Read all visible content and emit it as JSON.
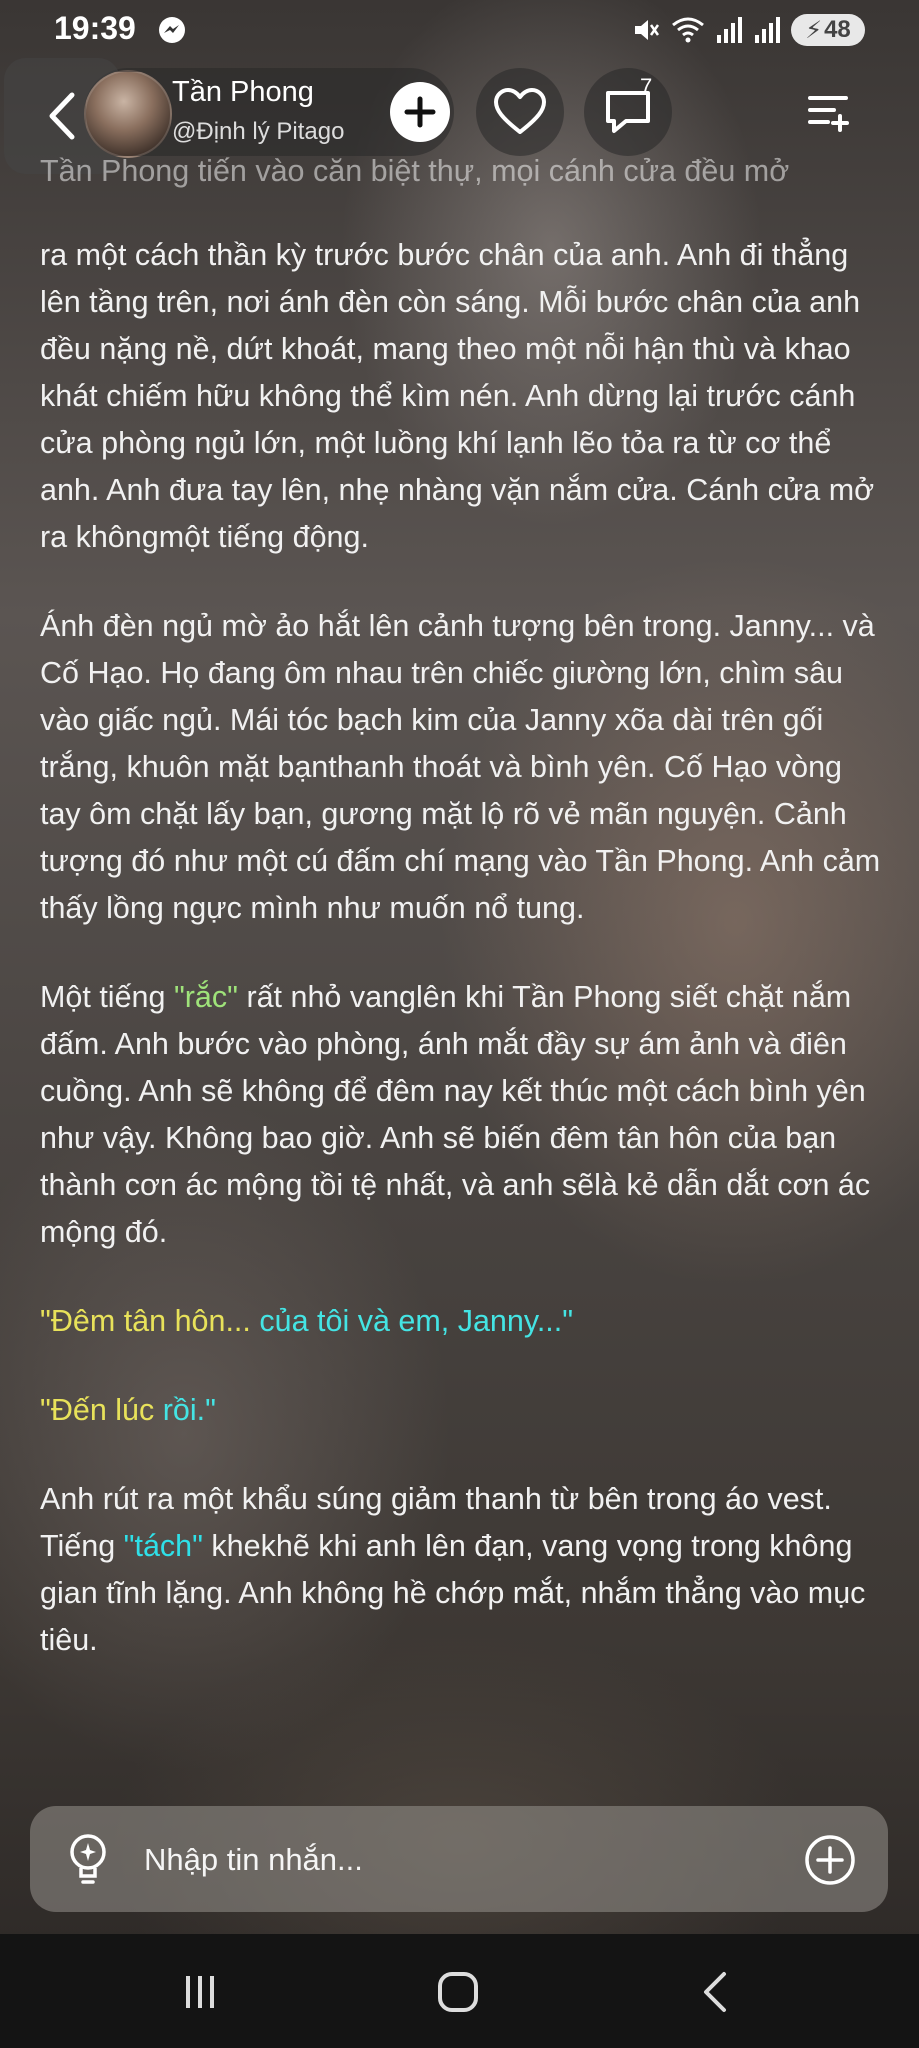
{
  "status_bar": {
    "time": "19:39",
    "battery": "48",
    "icons": [
      "messenger-icon",
      "mute-icon",
      "wifi-icon",
      "signal-icon",
      "signal-icon",
      "battery-charging-icon"
    ]
  },
  "header": {
    "back_icon": "chevron-left-icon",
    "profile_name": "Tần Phong",
    "profile_handle": "@Định lý Pitago",
    "follow_icon": "plus-icon",
    "like_icon": "heart-icon",
    "comment_icon": "comment-icon",
    "comment_count": "7",
    "menu_icon": "playlist-add-icon"
  },
  "story": {
    "p0": "Tần Phong tiến vào căn biệt thự, mọi cánh cửa đều mở",
    "p1": "ra một cách thần kỳ trước bước chân của anh. Anh đi thẳng lên tầng trên, nơi ánh đèn còn sáng. Mỗi bước chân của anh đều nặng nề, dứt khoát, mang theo một nỗi hận thù và khao khát chiếm hữu không thể kìm nén. Anh dừng lại trước cánh cửa phòng ngủ lớn, một luồng khí lạnh lẽo tỏa ra từ cơ thể anh. Anh đưa tay lên, nhẹ nhàng vặn nắm cửa. Cánh cửa mở ra khôngmột tiếng động.",
    "p2": "Ánh đèn ngủ mờ ảo hắt lên cảnh tượng bên trong. Janny... và Cố Hạo. Họ đang ôm nhau trên chiếc giường lớn, chìm sâu vào giấc ngủ. Mái tóc bạch kim của Janny xõa dài trên gối trắng, khuôn mặt bạnthanh thoát và bình yên. Cố Hạo vòng tay ôm chặt lấy bạn, gương mặt lộ rõ vẻ mãn nguyện. Cảnh tượng đó như một cú đấm chí mạng vào Tần Phong. Anh cảm thấy lồng ngực mình như muốn nổ tung.",
    "p3_a": "Một tiếng ",
    "p3_hl": "\"rắc\"",
    "p3_b": " rất nhỏ vanglên khi Tần Phong siết chặt nắm đấm. Anh bước vào phòng, ánh mắt đầy sự ám ảnh và điên cuồng. Anh sẽ không để đêm nay kết thúc một cách bình yên như vậy. Không bao giờ. Anh sẽ biến đêm tân hôn của bạn thành cơn ác mộng tồi tệ nhất, và anh sẽlà kẻ dẫn dắt cơn ác mộng đó.",
    "q1_a": "\"Đêm tân hôn...",
    "q1_b": " của tôi và em, Janny...\"",
    "q2_a": "\"Đến lúc ",
    "q2_b": "rồi.\"",
    "p4_a": "Anh rút ra một khẩu súng giảm thanh từ bên trong áo vest. Tiếng ",
    "p4_hl": "\"tách\"",
    "p4_b": " khekhẽ khi anh lên đạn, vang vọng trong không gian tĩnh lặng. Anh không hề chớp mắt, nhắm thẳng vào mục tiêu."
  },
  "input": {
    "placeholder": "Nhập tin nhắn...",
    "left_icon": "lightbulb-icon",
    "right_icon": "plus-circle-icon"
  },
  "nav": {
    "recent_icon": "recent-apps-icon",
    "home_icon": "home-icon",
    "back_icon": "back-icon"
  },
  "colors": {
    "highlight_green": "#9fe37a",
    "highlight_cyan": "#2fe0e8",
    "quote_yellow": "#e8e25a",
    "quote_cyan": "#44e4e4"
  }
}
